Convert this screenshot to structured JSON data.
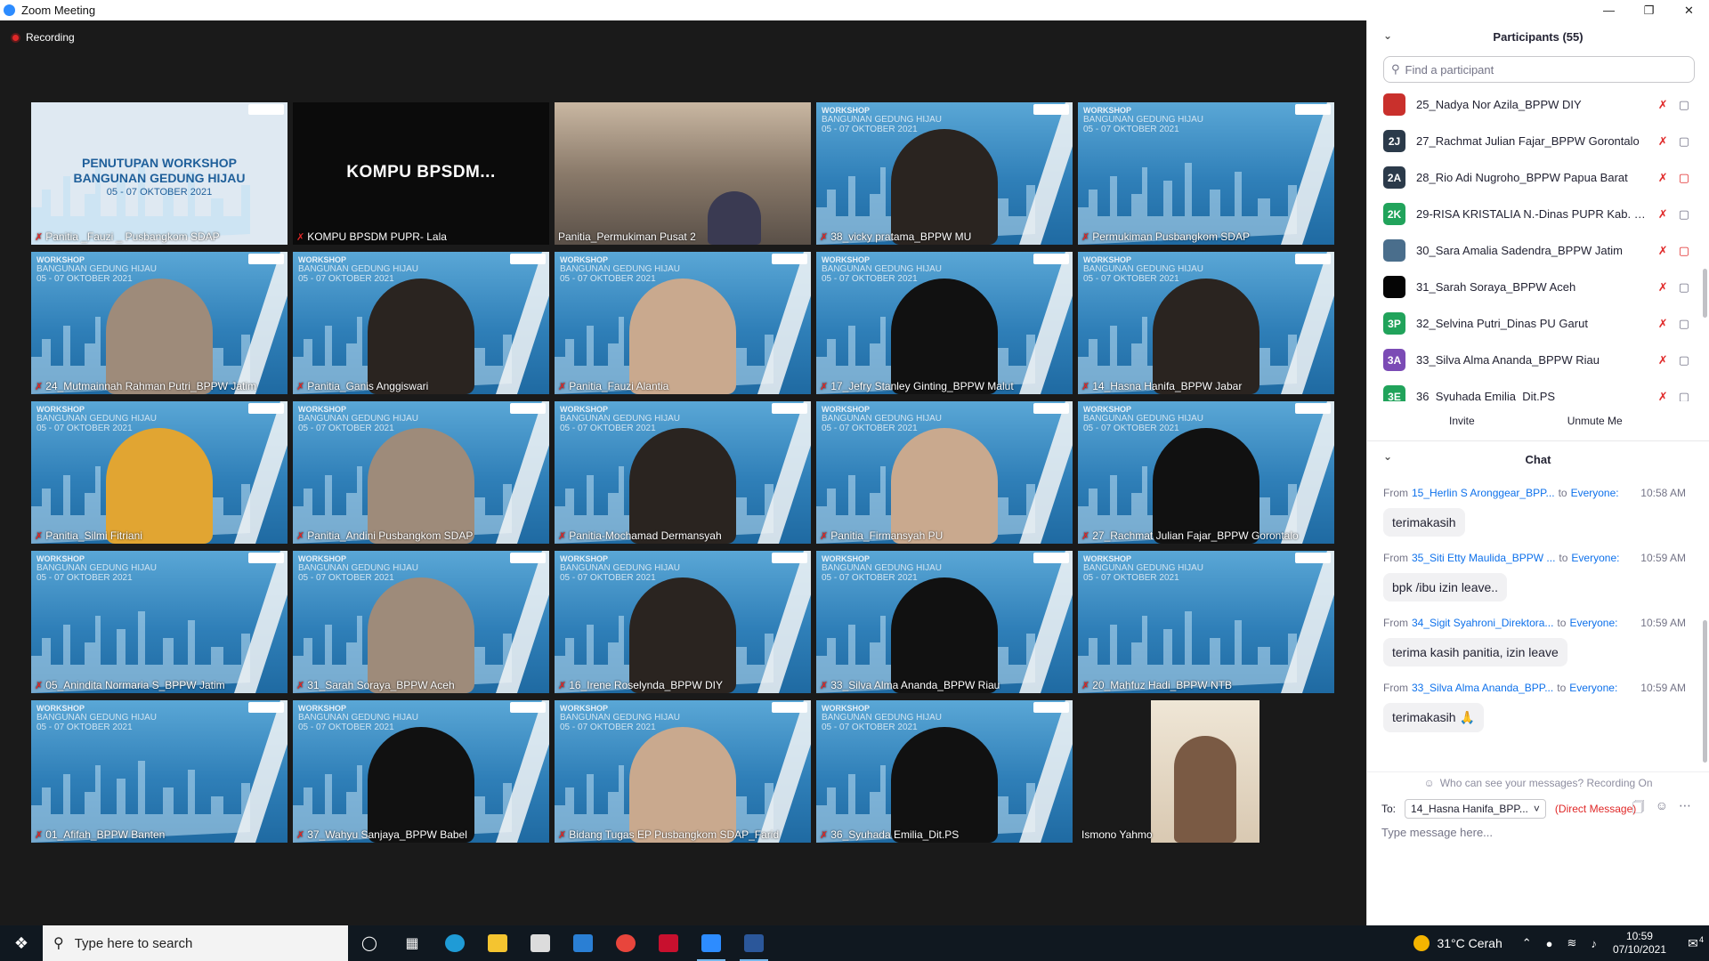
{
  "window": {
    "title": "Zoom Meeting"
  },
  "recording": {
    "label": "Recording"
  },
  "tiles": [
    {
      "kind": "cover",
      "name": "Panitia _Fauzi _ Pusbangkom SDAP",
      "cover_title": "PENUTUPAN WORKSHOP\nBANGUNAN GEDUNG HIJAU",
      "cover_date": "05 - 07 OKTOBER 2021",
      "muted": true
    },
    {
      "kind": "dark",
      "name": "KOMPU BPSDM PUPR- Lala",
      "big_label": "KOMPU  BPSDM...",
      "muted": true
    },
    {
      "kind": "room",
      "name": "Panitia_Permukiman Pusat 2",
      "muted": false
    },
    {
      "kind": "bg",
      "name": "38_vicky pratama_BPPW MU",
      "person": "dark",
      "muted": true
    },
    {
      "kind": "bg",
      "name": "Permukiman Pusbangkom SDAP",
      "person": "none",
      "muted": true
    },
    {
      "kind": "bg",
      "name": "24_Mutmainnah Rahman Putri_BPPW Jatim",
      "person": "hijab-b",
      "muted": true
    },
    {
      "kind": "bg",
      "name": "Panitia_Ganis Anggiswari",
      "person": "dark",
      "muted": true
    },
    {
      "kind": "bg",
      "name": "Panitia_Fauzi Alantia",
      "person": "light",
      "muted": true
    },
    {
      "kind": "bg",
      "name": "17_Jefry Stanley Ginting_BPPW Malut",
      "person": "hair",
      "muted": true
    },
    {
      "kind": "bg",
      "name": "14_Hasna Hanifa_BPPW Jabar",
      "person": "dark",
      "muted": true
    },
    {
      "kind": "bg",
      "name": "Panitia_Silmi Fitriani",
      "person": "hijab-y",
      "muted": true
    },
    {
      "kind": "bg",
      "name": "Panitia_Andini Pusbangkom SDAP",
      "person": "hijab-b",
      "muted": true
    },
    {
      "kind": "bg",
      "name": "Panitia-Mochamad Dermansyah",
      "person": "dark",
      "muted": true
    },
    {
      "kind": "bg",
      "name": "Panitia_Firmansyah PU",
      "person": "light",
      "muted": true
    },
    {
      "kind": "bg",
      "name": "27_Rachmat Julian Fajar_BPPW Gorontalo",
      "person": "hair",
      "muted": true
    },
    {
      "kind": "bg",
      "name": "05_Anindita Normaria S_BPPW Jatim",
      "person": "none",
      "muted": true
    },
    {
      "kind": "bg",
      "name": "31_Sarah Soraya_BPPW Aceh",
      "person": "hijab-b",
      "muted": true
    },
    {
      "kind": "bg",
      "name": "16_Irene Roselynda_BPPW DIY",
      "person": "dark",
      "muted": true
    },
    {
      "kind": "bg",
      "name": "33_Silva Alma Ananda_BPPW Riau",
      "person": "hair",
      "muted": true
    },
    {
      "kind": "bg",
      "name": "20_Mahfuz Hadi_BPPW NTB",
      "person": "none",
      "muted": true
    },
    {
      "kind": "bg",
      "name": "01_Afifah_BPPW Banten",
      "person": "none",
      "muted": true
    },
    {
      "kind": "bg",
      "name": "37_Wahyu Sanjaya_BPPW Babel",
      "person": "hair",
      "muted": true
    },
    {
      "kind": "bg",
      "name": "Bidang Tugas EP Pusbangkom SDAP_Farid",
      "person": "light",
      "muted": true
    },
    {
      "kind": "bg",
      "name": "36_Syuhada Emilia_Dit.PS",
      "person": "hair",
      "muted": true
    },
    {
      "kind": "partial",
      "name": "Ismono Yahmo",
      "muted": false
    }
  ],
  "tile_bg": {
    "top": "WORKSHOP",
    "sub": "BANGUNAN GEDUNG HIJAU\n05 - 07 OKTOBER 2021"
  },
  "participants": {
    "title": "Participants (55)",
    "search_placeholder": "Find a participant",
    "items": [
      {
        "initials": "",
        "color": "#c9302c",
        "name": "25_Nadya Nor Azila_BPPW DIY",
        "video_off": false
      },
      {
        "initials": "2J",
        "color": "#2b3a4a",
        "name": "27_Rachmat Julian Fajar_BPPW Gorontalo",
        "video_off": false
      },
      {
        "initials": "2A",
        "color": "#2b3a4a",
        "name": "28_Rio Adi Nugroho_BPPW Papua Barat",
        "video_off": true
      },
      {
        "initials": "2K",
        "color": "#21a35b",
        "name": "29-RISA KRISTALIA N.-Dinas PUPR Kab. Gar...",
        "video_off": false
      },
      {
        "initials": "",
        "color": "#4a6e8c",
        "name": "30_Sara Amalia Sadendra_BPPW Jatim",
        "video_off": true
      },
      {
        "initials": "",
        "color": "#050505",
        "name": "31_Sarah Soraya_BPPW Aceh",
        "video_off": false
      },
      {
        "initials": "3P",
        "color": "#21a35b",
        "name": "32_Selvina Putri_Dinas PU Garut",
        "video_off": false
      },
      {
        "initials": "3A",
        "color": "#7b4bb5",
        "name": "33_Silva Alma Ananda_BPPW Riau",
        "video_off": false
      },
      {
        "initials": "3E",
        "color": "#21a35b",
        "name": "36_Syuhada Emilia_Dit.PS",
        "video_off": false
      }
    ],
    "invite_label": "Invite",
    "unmute_label": "Unmute Me"
  },
  "chat": {
    "title": "Chat",
    "messages": [
      {
        "from_label": "From",
        "sender": "15_Herlin S Aronggear_BPP...",
        "to_label": "to",
        "to_who": "Everyone:",
        "time": "10:58 AM",
        "text": "terimakasih"
      },
      {
        "from_label": "From",
        "sender": "35_Siti Etty Maulida_BPPW ...",
        "to_label": "to",
        "to_who": "Everyone:",
        "time": "10:59 AM",
        "text": "bpk /ibu izin leave.."
      },
      {
        "from_label": "From",
        "sender": "34_Sigit Syahroni_Direktora...",
        "to_label": "to",
        "to_who": "Everyone:",
        "time": "10:59 AM",
        "text": "terima kasih panitia, izin leave"
      },
      {
        "from_label": "From",
        "sender": "33_Silva Alma Ananda_BPP...",
        "to_label": "to",
        "to_who": "Everyone:",
        "time": "10:59 AM",
        "text": "terimakasih 🙏"
      }
    ],
    "who_can_see": "Who can see your messages? Recording On",
    "to_label": "To:",
    "to_value": "14_Hasna Hanifa_BPP...",
    "direct_message": "(Direct Message)",
    "input_placeholder": "Type message here..."
  },
  "taskbar": {
    "search_placeholder": "Type here to search",
    "weather": "31°C  Cerah",
    "time": "10:59",
    "date": "07/10/2021",
    "notifications": "4"
  }
}
